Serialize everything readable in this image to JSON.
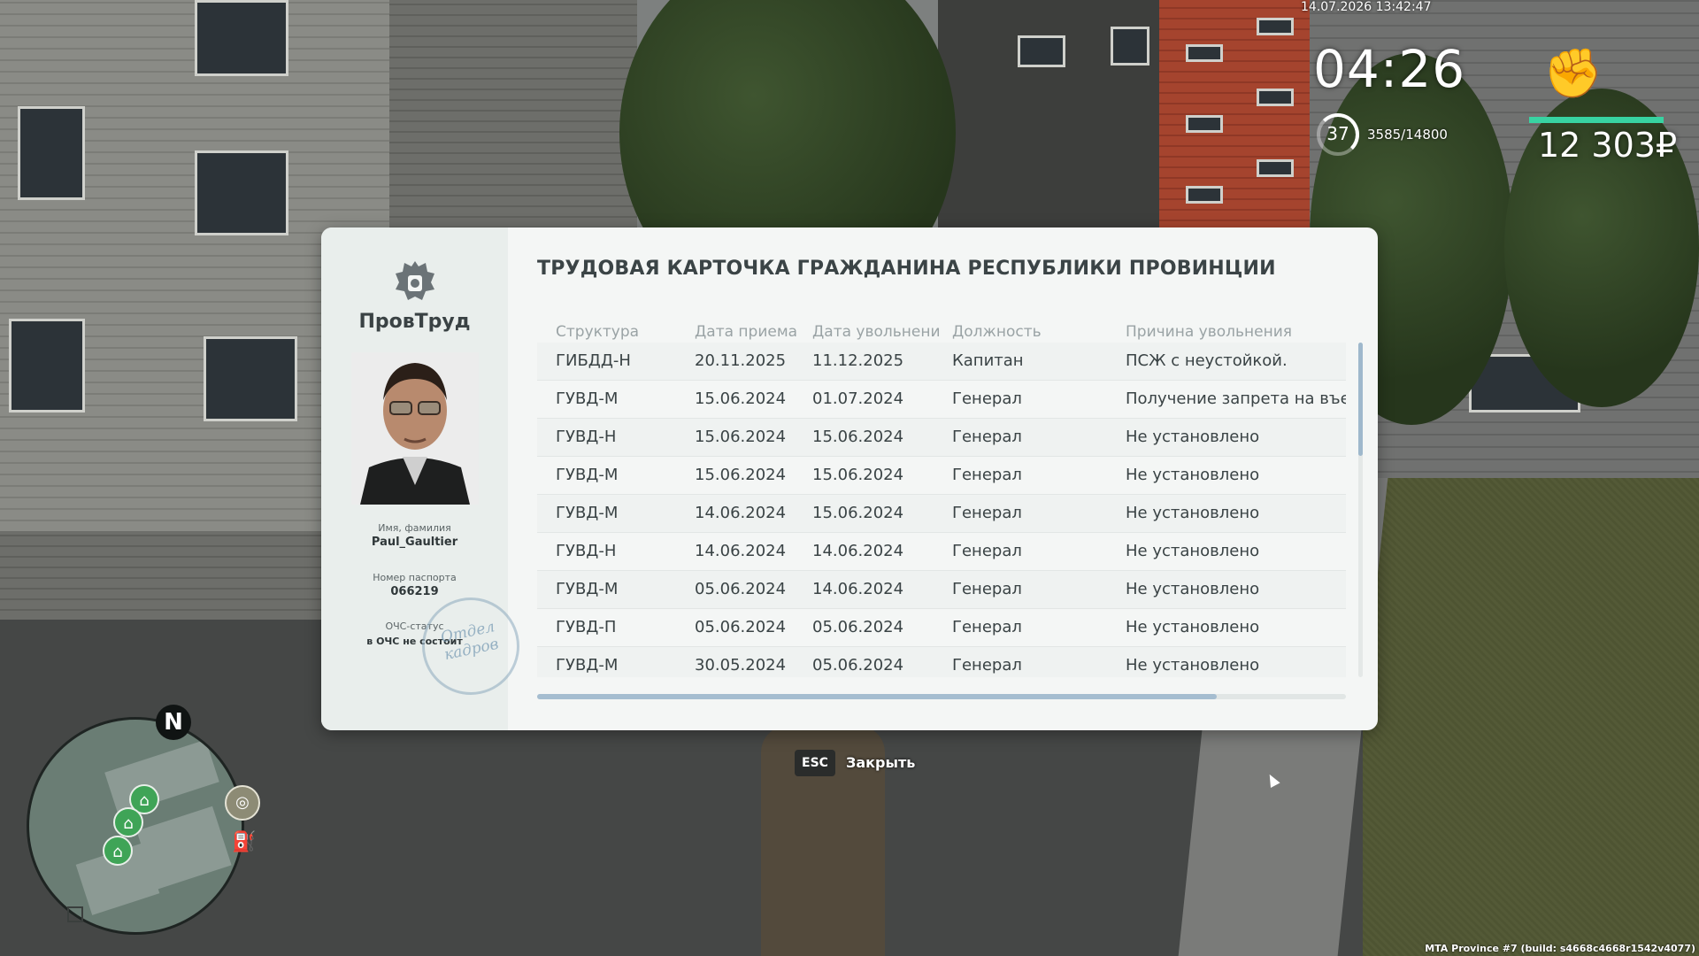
{
  "hud": {
    "datetime": "14.07.2026 13:42:47",
    "time": "04:26",
    "level": "37",
    "xp": "3585/14800",
    "money": "12 303₽",
    "accent_color": "#38d3a2"
  },
  "card": {
    "org_name": "ПровТруд",
    "title": "ТРУДОВАЯ КАРТОЧКА ГРАЖДАНИНА РЕСПУБЛИКИ ПРОВИНЦИИ",
    "name_label": "Имя, фамилия",
    "name_value": "Paul_Gaultier",
    "passport_label": "Номер паспорта",
    "passport_value": "066219",
    "ochs_label": "ОЧС-статус",
    "ochs_value": "в ОЧС не состоит",
    "stamp_text": "Отдел кадров",
    "columns": [
      "Структура",
      "Дата приема",
      "Дата увольнени",
      "Должность",
      "Причина увольнения"
    ],
    "rows": [
      [
        "ГИБДД-Н",
        "20.11.2025",
        "11.12.2025",
        "Капитан",
        "ПСЖ с неустойкой."
      ],
      [
        "ГУВД-М",
        "15.06.2024",
        "01.07.2024",
        "Генерал",
        "Получение запрета на въезд"
      ],
      [
        "ГУВД-Н",
        "15.06.2024",
        "15.06.2024",
        "Генерал",
        "Не установлено"
      ],
      [
        "ГУВД-М",
        "15.06.2024",
        "15.06.2024",
        "Генерал",
        "Не установлено"
      ],
      [
        "ГУВД-М",
        "14.06.2024",
        "15.06.2024",
        "Генерал",
        "Не установлено"
      ],
      [
        "ГУВД-Н",
        "14.06.2024",
        "14.06.2024",
        "Генерал",
        "Не установлено"
      ],
      [
        "ГУВД-М",
        "05.06.2024",
        "14.06.2024",
        "Генерал",
        "Не установлено"
      ],
      [
        "ГУВД-П",
        "05.06.2024",
        "05.06.2024",
        "Генерал",
        "Не установлено"
      ],
      [
        "ГУВД-М",
        "30.05.2024",
        "05.06.2024",
        "Генерал",
        "Не установлено"
      ]
    ]
  },
  "footer": {
    "esc_key": "ESC",
    "close_label": "Закрыть"
  },
  "minimap": {
    "north": "N",
    "icons": [
      "home-icon",
      "house-icon",
      "house-icon",
      "pizza-icon",
      "fuel-icon"
    ]
  },
  "build_info": "MTA Province #7 (build: s4668c4668r1542v4077)"
}
